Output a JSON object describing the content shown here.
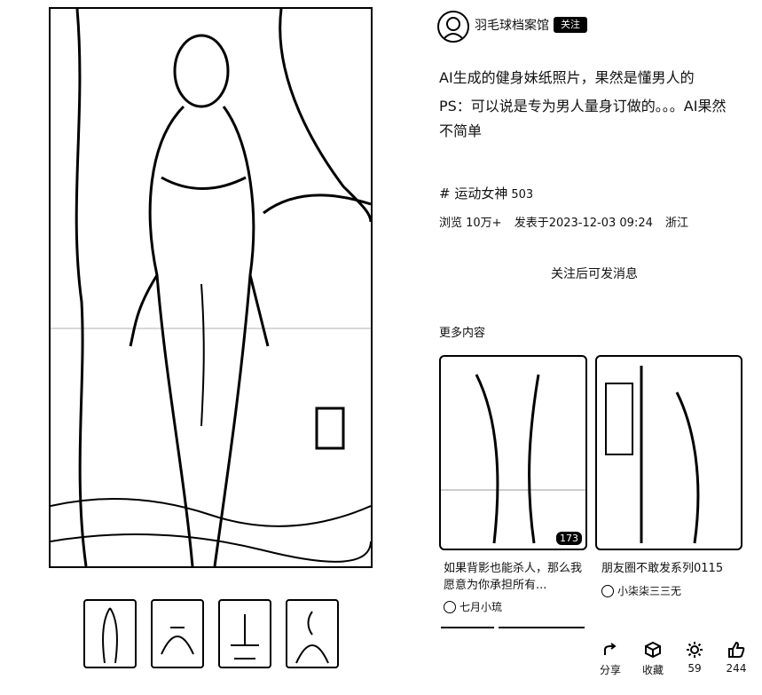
{
  "author": {
    "name": "羽毛球档案馆",
    "follow_label": "关注"
  },
  "post": {
    "title": "AI生成的健身妹纸照片，果然是懂男人的",
    "body": "PS：可以说是专为男人量身订做的。。。AI果然不简单",
    "tag": "# 运动女神",
    "tag_count": "503",
    "views": "浏览 10万+",
    "published": "发表于2023-12-03 09:24",
    "location": "浙江"
  },
  "message_hint": "关注后可发消息",
  "more_title": "更多内容",
  "cards": [
    {
      "title": "如果背影也能杀人，那么我愿意为你承担所有...",
      "author": "七月小琉",
      "count": "173"
    },
    {
      "title": "朋友圈不敢发系列0115",
      "author": "小柒柒三三无",
      "count": ""
    }
  ],
  "actions": [
    {
      "icon": "share-icon",
      "label": "分享"
    },
    {
      "icon": "cube-icon",
      "label": "收藏"
    },
    {
      "icon": "gear-icon",
      "label": "59"
    },
    {
      "icon": "thumbs-up-icon",
      "label": "244"
    }
  ]
}
